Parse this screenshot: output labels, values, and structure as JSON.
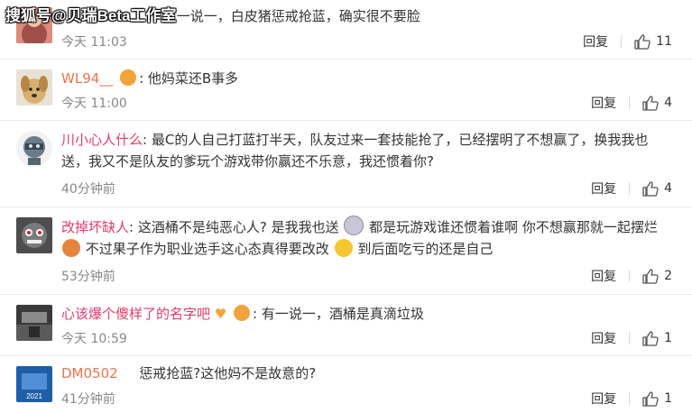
{
  "watermark": "搜狐号@贝瑞Beta工作室",
  "comments": [
    {
      "username": "​",
      "text": "有一说一，白皮猪惩戒抢蓝，确实很不要脸",
      "time": "今天 11:03",
      "reply_label": "回复",
      "likes": "11"
    },
    {
      "username": "WL94__",
      "text": "他妈菜还B事多",
      "time": "今天 11:00",
      "reply_label": "回复",
      "likes": "4"
    },
    {
      "username": "川小心人什么",
      "text": "最C的人自己打蓝打半天，队友过来一套技能抢了，已经摆明了不想赢了，换我我也送，我又不是队友的爹玩个游戏带你赢还不乐意，我还惯着你?",
      "time": "40分钟前",
      "reply_label": "回复",
      "likes": "4"
    },
    {
      "username": "改掉坏缺人",
      "text_1": "这酒桶不是纯恶心人? 是我我也送",
      "text_2": "都是玩游戏谁还惯着谁啊 你不想赢那就一起摆烂",
      "text_3": "不过果子作为职业选手这心态真得要改改",
      "text_4": "到后面吃亏的还是自己",
      "time": "53分钟前",
      "reply_label": "回复",
      "likes": "2"
    },
    {
      "username": "心该爆个傻样了的名字吧",
      "text": "有一说一，酒桶是真滴垃圾",
      "time": "今天 10:59",
      "reply_label": "回复",
      "likes": "1"
    },
    {
      "username": "DM0502",
      "text": "惩戒抢蓝?这他妈不是故意的?",
      "time": "41分钟前",
      "reply_label": "回复",
      "likes": "1",
      "avatar_text": "2021"
    }
  ],
  "colors": {
    "username_orange": "#eb7350",
    "username_pink": "#e63a6c",
    "time": "#888888",
    "divider": "#ececec"
  },
  "icons": {
    "like": "thumbs-up-icon",
    "vip_badge": "vip-badge-icon"
  }
}
